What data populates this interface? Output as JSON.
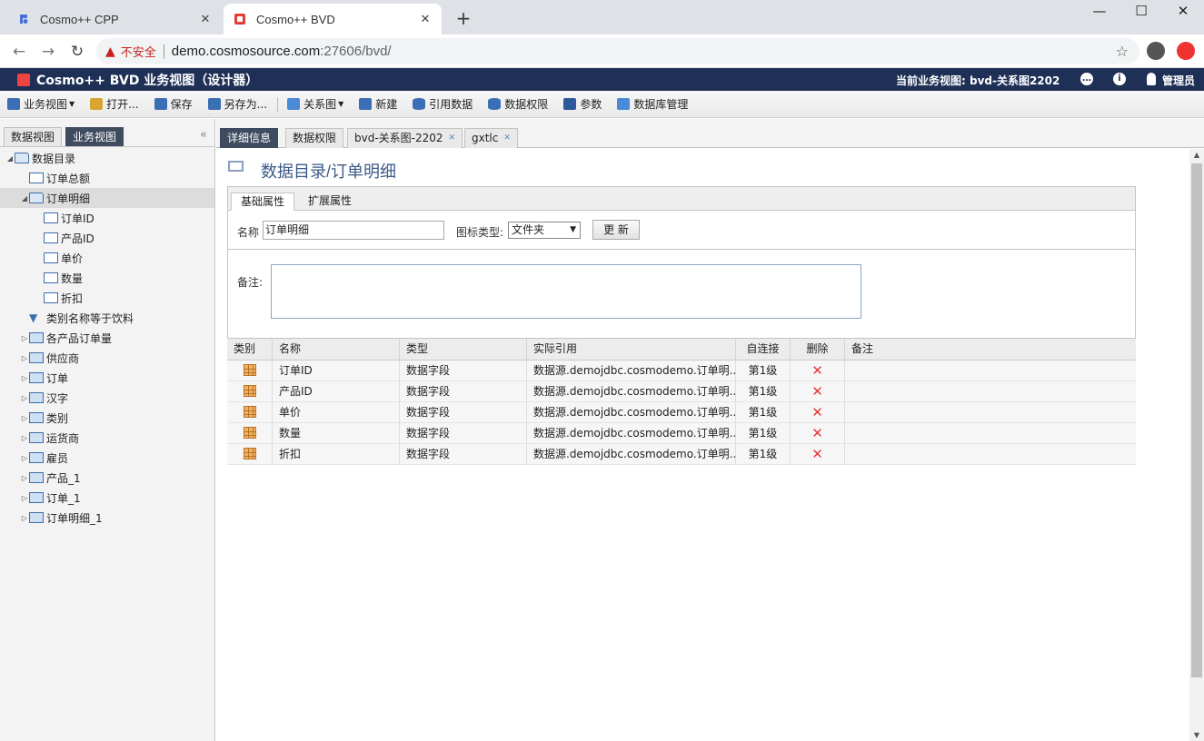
{
  "browser": {
    "tabs": [
      {
        "title": "Cosmo++ CPP",
        "active": false
      },
      {
        "title": "Cosmo++ BVD",
        "active": true
      }
    ],
    "security_label": "不安全",
    "url_host": "demo.cosmosource.com",
    "url_rest": ":27606/bvd/"
  },
  "app": {
    "title": "Cosmo++ BVD 业务视图（设计器）",
    "current_view": "当前业务视图: bvd-关系图2202",
    "user": "管理员"
  },
  "toolbar": [
    {
      "label": "业务视图",
      "dropdown": true,
      "color": "#3a6fb5"
    },
    {
      "label": "打开...",
      "dropdown": false,
      "color": "#3a6fb5"
    },
    {
      "label": "保存",
      "dropdown": false,
      "color": "#3a6fb5"
    },
    {
      "label": "另存为...",
      "dropdown": false,
      "color": "#3a6fb5"
    },
    {
      "label": "关系图",
      "dropdown": true,
      "color": "#3a6fb5"
    },
    {
      "label": "新建",
      "dropdown": false,
      "color": "#3a6fb5"
    },
    {
      "label": "引用数据",
      "dropdown": false,
      "color": "#3a6fb5"
    },
    {
      "label": "数据权限",
      "dropdown": false,
      "color": "#3a6fb5"
    },
    {
      "label": "参数",
      "dropdown": false,
      "color": "#3a6fb5"
    },
    {
      "label": "数据库管理",
      "dropdown": false,
      "color": "#3a6fb5"
    }
  ],
  "left_tabs": [
    "数据视图",
    "业务视图"
  ],
  "tree": [
    {
      "label": "数据目录",
      "level": 0,
      "expanded": true,
      "type": "folder"
    },
    {
      "label": "订单总额",
      "level": 1,
      "type": "calc"
    },
    {
      "label": "订单明细",
      "level": 1,
      "expanded": true,
      "type": "folder",
      "selected": true
    },
    {
      "label": "订单ID",
      "level": 2,
      "type": "num"
    },
    {
      "label": "产品ID",
      "level": 2,
      "type": "num"
    },
    {
      "label": "单价",
      "level": 2,
      "type": "num"
    },
    {
      "label": "数量",
      "level": 2,
      "type": "num"
    },
    {
      "label": "折扣",
      "level": 2,
      "type": "num"
    },
    {
      "label": "类别名称等于饮料",
      "level": 1,
      "type": "filter"
    },
    {
      "label": "各产品订单量",
      "level": 1,
      "expanded": false,
      "type": "table"
    },
    {
      "label": "供应商",
      "level": 1,
      "expanded": false,
      "type": "table"
    },
    {
      "label": "订单",
      "level": 1,
      "expanded": false,
      "type": "table"
    },
    {
      "label": "汉字",
      "level": 1,
      "expanded": false,
      "type": "table"
    },
    {
      "label": "类别",
      "level": 1,
      "expanded": false,
      "type": "table"
    },
    {
      "label": "运货商",
      "level": 1,
      "expanded": false,
      "type": "table"
    },
    {
      "label": "雇员",
      "level": 1,
      "expanded": false,
      "type": "table"
    },
    {
      "label": "产品_1",
      "level": 1,
      "expanded": false,
      "type": "table"
    },
    {
      "label": "订单_1",
      "level": 1,
      "expanded": false,
      "type": "table"
    },
    {
      "label": "订单明细_1",
      "level": 1,
      "expanded": false,
      "type": "table"
    }
  ],
  "right_tabs": [
    {
      "label": "详细信息",
      "closable": false
    },
    {
      "label": "数据权限",
      "closable": false
    },
    {
      "label": "bvd-关系图-2202",
      "closable": true
    },
    {
      "label": "gxtlc",
      "closable": true
    }
  ],
  "detail": {
    "breadcrumb": "数据目录/订单明细",
    "tabs": [
      "基础属性",
      "扩展属性"
    ],
    "name_label": "名称",
    "name_value": "订单明细",
    "icon_type_label": "图标类型:",
    "icon_type_value": "文件夹",
    "update_label": "更 新",
    "memo_label": "备注:",
    "memo_value": ""
  },
  "grid": {
    "columns": [
      "类别",
      "名称",
      "类型",
      "实际引用",
      "自连接",
      "删除",
      "备注"
    ],
    "rows": [
      {
        "name": "订单ID",
        "type": "数据字段",
        "ref": "数据源.demojdbc.cosmodemo.订单明...",
        "join": "第1级",
        "note": ""
      },
      {
        "name": "产品ID",
        "type": "数据字段",
        "ref": "数据源.demojdbc.cosmodemo.订单明...",
        "join": "第1级",
        "note": ""
      },
      {
        "name": "单价",
        "type": "数据字段",
        "ref": "数据源.demojdbc.cosmodemo.订单明...",
        "join": "第1级",
        "note": ""
      },
      {
        "name": "数量",
        "type": "数据字段",
        "ref": "数据源.demojdbc.cosmodemo.订单明...",
        "join": "第1级",
        "note": ""
      },
      {
        "name": "折扣",
        "type": "数据字段",
        "ref": "数据源.demojdbc.cosmodemo.订单明...",
        "join": "第1级",
        "note": ""
      }
    ]
  }
}
